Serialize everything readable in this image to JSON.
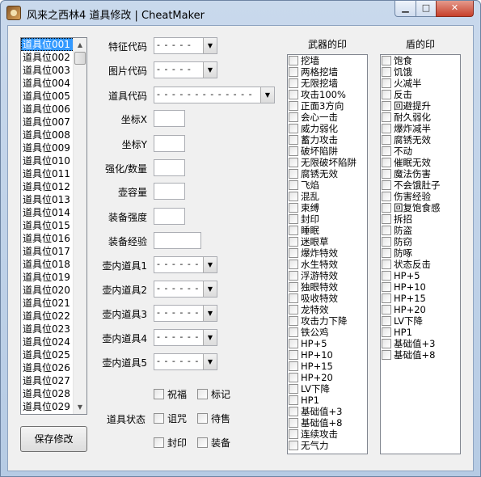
{
  "window": {
    "title": "风来之西林4 道具修改 | CheatMaker",
    "minimize_glyph": "▁",
    "maximize_glyph": "□",
    "close_glyph": "✕"
  },
  "item_list": {
    "items": [
      "道具位001",
      "道具位002",
      "道具位003",
      "道具位004",
      "道具位005",
      "道具位006",
      "道具位007",
      "道具位008",
      "道具位009",
      "道具位010",
      "道具位011",
      "道具位012",
      "道具位013",
      "道具位014",
      "道具位015",
      "道具位016",
      "道具位017",
      "道具位018",
      "道具位019",
      "道具位020",
      "道具位021",
      "道具位022",
      "道具位023",
      "道具位024",
      "道具位025",
      "道具位026",
      "道具位027",
      "道具位028",
      "道具位029"
    ],
    "selected_index": 0,
    "up_glyph": "▲",
    "down_glyph": "▼"
  },
  "save_button": "保存修改",
  "form": {
    "feature_code": {
      "label": "特征代码",
      "value": "- - - - -"
    },
    "image_code": {
      "label": "图片代码",
      "value": "- - - - -"
    },
    "item_code": {
      "label": "道具代码",
      "value": "- - - - - - - - - - - - -"
    },
    "coord_x": {
      "label": "坐标X",
      "value": ""
    },
    "coord_y": {
      "label": "坐标Y",
      "value": ""
    },
    "enhance_qty": {
      "label": "强化/数量",
      "value": ""
    },
    "pot_capacity": {
      "label": "壶容量",
      "value": ""
    },
    "equip_strength": {
      "label": "装备强度",
      "value": ""
    },
    "equip_exp": {
      "label": "装备经验",
      "value": ""
    },
    "pot_items": [
      {
        "label": "壶内道具1",
        "value": "- - - - - -"
      },
      {
        "label": "壶内道具2",
        "value": "- - - - - -"
      },
      {
        "label": "壶内道具3",
        "value": "- - - - - -"
      },
      {
        "label": "壶内道具4",
        "value": "- - - - - -"
      },
      {
        "label": "壶内道具5",
        "value": "- - - - - -"
      }
    ],
    "drop_glyph": "▼"
  },
  "item_state": {
    "label": "道具状态",
    "options": [
      "祝福",
      "标记",
      "诅咒",
      "待售",
      "封印",
      "装备"
    ]
  },
  "weapon_seals": {
    "title": "武器的印",
    "items": [
      "挖墙",
      "两格挖墙",
      "无限挖墙",
      "攻击100%",
      "正面3方向",
      "会心一击",
      "威力弱化",
      "蓄力攻击",
      "破坏陷阱",
      "无限破坏陷阱",
      "腐锈无效",
      "飞焰",
      "混乱",
      "束缚",
      "封印",
      "睡眠",
      "迷眼草",
      "爆炸特效",
      "水生特效",
      "浮游特效",
      "独眼特效",
      "吸收特效",
      "龙特效",
      "攻击力下降",
      "铁公鸡",
      "HP+5",
      "HP+10",
      "HP+15",
      "HP+20",
      "LV下降",
      "HP1",
      "基础值+3",
      "基础值+8",
      "连续攻击",
      "无气力"
    ]
  },
  "shield_seals": {
    "title": "盾的印",
    "items": [
      "饱食",
      "饥饿",
      "火减半",
      "反击",
      "回避提升",
      "耐久弱化",
      "爆炸减半",
      "腐锈无效",
      "不动",
      "催眠无效",
      "魔法伤害",
      "不会饿肚子",
      "伤害经验",
      "回复饱食感",
      "拆招",
      "防盗",
      "防窃",
      "防啄",
      "状态反击",
      "HP+5",
      "HP+10",
      "HP+15",
      "HP+20",
      "LV下降",
      "HP1",
      "基础值+3",
      "基础值+8"
    ]
  }
}
